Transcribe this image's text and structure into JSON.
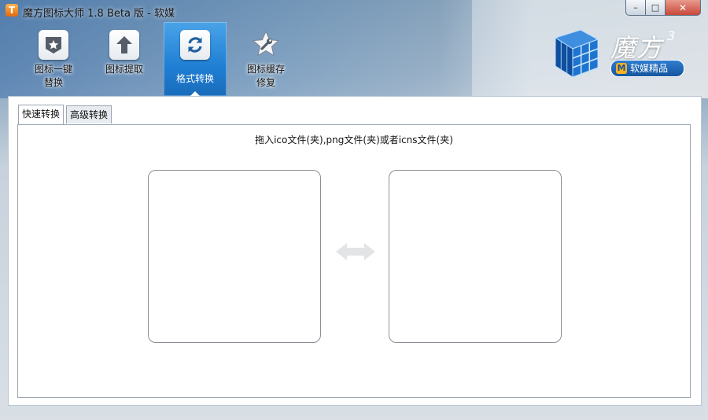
{
  "window": {
    "title": "魔方图标大师 1.8 Beta 版 - 软媒",
    "app_icon_letter": "T",
    "controls": {
      "minimize": "–",
      "maximize": "□",
      "close": "✕"
    }
  },
  "toolbar": {
    "items": [
      {
        "label": "图标一键\n替换",
        "icon": "star-badge-icon",
        "active": false
      },
      {
        "label": "图标提取",
        "icon": "arrow-up-icon",
        "active": false
      },
      {
        "label": "格式转换",
        "icon": "refresh-icon",
        "active": true
      },
      {
        "label": "图标缓存\n修复",
        "icon": "star-wrench-icon",
        "active": false
      }
    ]
  },
  "logo": {
    "word": "魔方",
    "version": "3",
    "badge_letter": "M",
    "badge_text": "软媒精品"
  },
  "tabs": [
    {
      "label": "快速转换",
      "active": true
    },
    {
      "label": "高级转换",
      "active": false
    }
  ],
  "panel": {
    "hint": "拖入ico文件(夹),png文件(夹)或者icns文件(夹)"
  },
  "colors": {
    "accent": "#1f7fd4",
    "close_button": "#c9483a"
  }
}
